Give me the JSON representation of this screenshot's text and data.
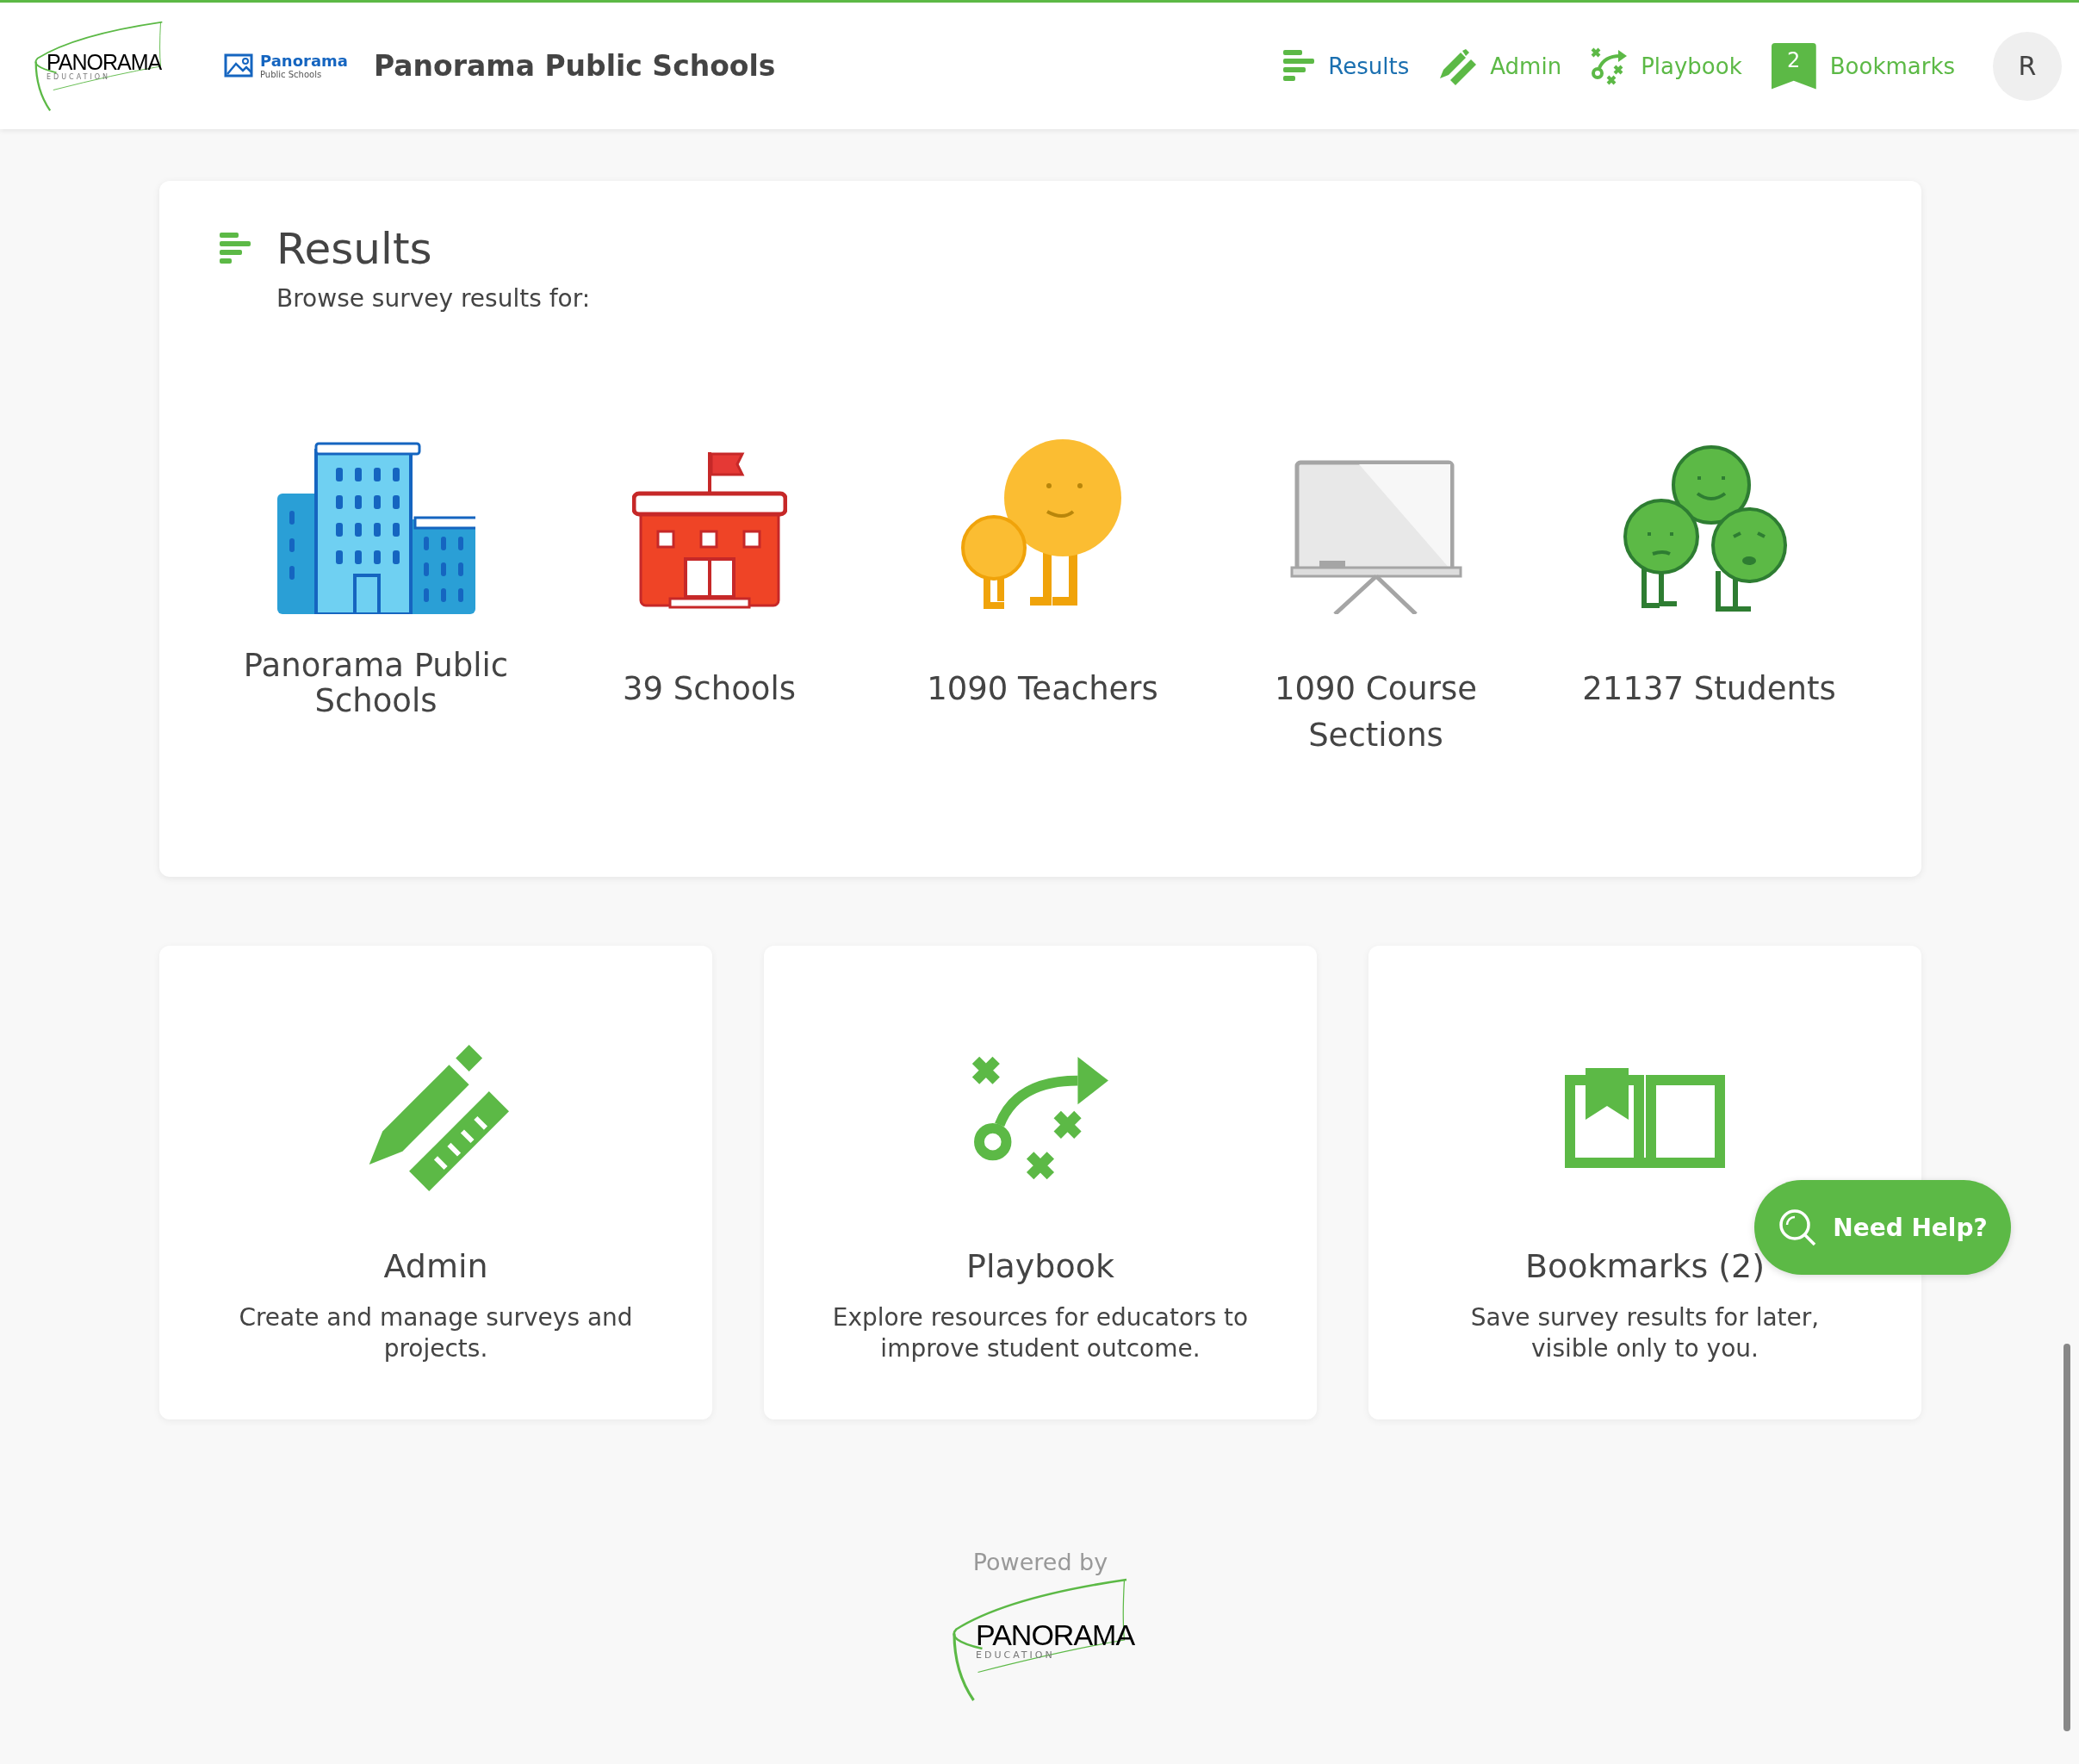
{
  "header": {
    "logo": {
      "wordmark": "PANORAMA",
      "tagline": "EDUCATION"
    },
    "district_logo": {
      "name": "Panorama",
      "subtitle": "Public Schools"
    },
    "title": "Panorama Public Schools",
    "nav": [
      {
        "kind": "results",
        "label": "Results",
        "selected": true
      },
      {
        "kind": "admin",
        "label": "Admin",
        "selected": false
      },
      {
        "kind": "playbook",
        "label": "Playbook",
        "selected": false
      },
      {
        "kind": "bookmarks",
        "label": "Bookmarks",
        "badge": "2",
        "selected": false
      }
    ],
    "avatar": "R"
  },
  "results": {
    "title": "Results",
    "subtitle": "Browse survey results for:",
    "items": [
      {
        "kind": "district",
        "label": "Panorama Public Schools"
      },
      {
        "kind": "schools",
        "label": "39 Schools"
      },
      {
        "kind": "teachers",
        "label": "1090 Teachers"
      },
      {
        "kind": "sections",
        "label": "1090 Course Sections"
      },
      {
        "kind": "students",
        "label": "21137 Students"
      }
    ]
  },
  "cards": [
    {
      "kind": "admin",
      "title": "Admin",
      "description": "Create and manage surveys and projects."
    },
    {
      "kind": "playbook",
      "title": "Playbook",
      "description": "Explore resources for educators to improve student outcome."
    },
    {
      "kind": "bookmarks",
      "title": "Bookmarks (2)",
      "description": "Save survey results for later, visible only to you."
    }
  ],
  "help_button": "Need Help?",
  "footer": {
    "powered_by": "Powered by",
    "logo": {
      "wordmark": "PANORAMA",
      "tagline": "EDUCATION"
    }
  }
}
